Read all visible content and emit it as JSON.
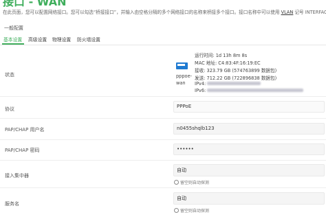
{
  "page": {
    "title": "接口 - WAN",
    "description": "在此页面，您可以配置网络接口。您可以勾选“桥接接口”，并输入由空格分隔的多个网络接口的名称来桥接多个接口。接口名称中可以使用",
    "vlan_link": "VLAN",
    "vlan_suffix": "记号 INTERFACE."
  },
  "section": {
    "title": "一般配置"
  },
  "tabs": [
    {
      "label": "基本设置",
      "active": true
    },
    {
      "label": "高级设置"
    },
    {
      "label": "物理设置"
    },
    {
      "label": "防火墙设置"
    }
  ],
  "status": {
    "label": "状态",
    "interface_name_line1": "pppoe-",
    "interface_name_line2": "wan",
    "uptime": "运行时间: 1d 13h 8m 8s",
    "mac": "MAC 地址: C4:83:4F:16:19:EC",
    "rx": "接收: 323.79 GB (574763899 数据包)",
    "tx": "发送: 712.22 GB (722896838 数据包)",
    "ipv4_prefix": "IPv4:",
    "ipv6_prefix": "IPv6:"
  },
  "protocol": {
    "label": "协议",
    "value": "PPPoE"
  },
  "username": {
    "label": "PAP/CHAP 用户名",
    "value": "n0455shqlb123"
  },
  "password": {
    "label": "PAP/CHAP 密码",
    "value": "••••••"
  },
  "access_concentrator": {
    "label": "接入集中器",
    "value": "自动",
    "hint": "留空则自动探测"
  },
  "service_name": {
    "label": "服务名",
    "value": "自动",
    "hint": "留空则自动探测"
  }
}
